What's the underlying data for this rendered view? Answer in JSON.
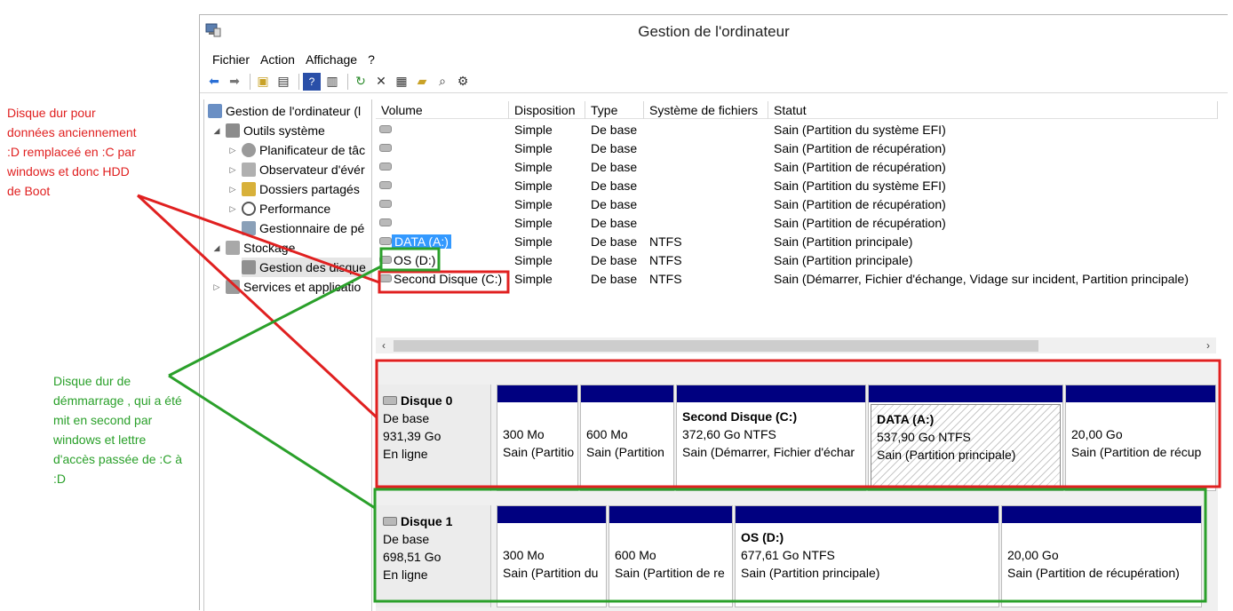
{
  "annotations": {
    "red_note": "Disque dur pour\ndonnées anciennement\n:D remplaceé en :C par\nwindows et donc HDD\nde Boot",
    "green_note": "Disque dur de\ndémmarrage , qui a été\nmit en second par\nwindows et lettre\nd'accès passée de :C à\n:D",
    "red_color": "#e02020",
    "green_color": "#2aa02a"
  },
  "window": {
    "title": "Gestion de l'ordinateur",
    "menu": [
      "Fichier",
      "Action",
      "Affichage",
      "?"
    ]
  },
  "tree": {
    "items": [
      {
        "label": "Gestion de l'ordinateur (l",
        "level": 0,
        "expander": "",
        "icon": "computer-management-icon"
      },
      {
        "label": "Outils système",
        "level": 1,
        "expander": "◢",
        "icon": "system-tools-icon"
      },
      {
        "label": "Planificateur de tâc",
        "level": 2,
        "expander": "▷",
        "icon": "task-scheduler-icon"
      },
      {
        "label": "Observateur d'évér",
        "level": 2,
        "expander": "▷",
        "icon": "event-viewer-icon"
      },
      {
        "label": "Dossiers partagés",
        "level": 2,
        "expander": "▷",
        "icon": "shared-folders-icon"
      },
      {
        "label": "Performance",
        "level": 2,
        "expander": "▷",
        "icon": "performance-icon"
      },
      {
        "label": "Gestionnaire de pé",
        "level": 2,
        "expander": "",
        "icon": "device-manager-icon"
      },
      {
        "label": "Stockage",
        "level": 1,
        "expander": "◢",
        "icon": "storage-icon"
      },
      {
        "label": "Gestion des disque",
        "level": 2,
        "expander": "",
        "icon": "disk-management-icon",
        "selected": true
      },
      {
        "label": "Services et applicatio",
        "level": 1,
        "expander": "▷",
        "icon": "services-icon"
      }
    ]
  },
  "volumes": {
    "columns": [
      "Volume",
      "Disposition",
      "Type",
      "Système de fichiers",
      "Statut"
    ],
    "rows": [
      {
        "name": "",
        "layout": "Simple",
        "type": "De base",
        "fs": "",
        "status": "Sain (Partition du système EFI)"
      },
      {
        "name": "",
        "layout": "Simple",
        "type": "De base",
        "fs": "",
        "status": "Sain (Partition de récupération)"
      },
      {
        "name": "",
        "layout": "Simple",
        "type": "De base",
        "fs": "",
        "status": "Sain (Partition de récupération)"
      },
      {
        "name": "",
        "layout": "Simple",
        "type": "De base",
        "fs": "",
        "status": "Sain (Partition du système EFI)"
      },
      {
        "name": "",
        "layout": "Simple",
        "type": "De base",
        "fs": "",
        "status": "Sain (Partition de récupération)"
      },
      {
        "name": "",
        "layout": "Simple",
        "type": "De base",
        "fs": "",
        "status": "Sain (Partition de récupération)"
      },
      {
        "name": "DATA (A:)",
        "layout": "Simple",
        "type": "De base",
        "fs": "NTFS",
        "status": "Sain (Partition principale)",
        "selected": true
      },
      {
        "name": "OS (D:)",
        "layout": "Simple",
        "type": "De base",
        "fs": "NTFS",
        "status": "Sain (Partition principale)"
      },
      {
        "name": "Second Disque (C:)",
        "layout": "Simple",
        "type": "De base",
        "fs": "NTFS",
        "status": "Sain (Démarrer, Fichier d'échange, Vidage sur incident, Partition principale)"
      }
    ]
  },
  "disks": [
    {
      "name": "Disque 0",
      "kind": "De base",
      "size": "931,39 Go",
      "state": "En ligne",
      "partitions": [
        {
          "title": "",
          "size": "300 Mo",
          "status": "Sain (Partitio"
        },
        {
          "title": "",
          "size": "600 Mo",
          "status": "Sain (Partition"
        },
        {
          "title": "Second Disque  (C:)",
          "size": "372,60 Go NTFS",
          "status": "Sain (Démarrer, Fichier d'échar"
        },
        {
          "title": "DATA  (A:)",
          "size": "537,90 Go NTFS",
          "status": "Sain (Partition principale)",
          "hatched": true
        },
        {
          "title": "",
          "size": "20,00 Go",
          "status": "Sain (Partition de récup"
        }
      ]
    },
    {
      "name": "Disque 1",
      "kind": "De base",
      "size": "698,51 Go",
      "state": "En ligne",
      "partitions": [
        {
          "title": "",
          "size": "300 Mo",
          "status": "Sain (Partition du"
        },
        {
          "title": "",
          "size": "600 Mo",
          "status": "Sain (Partition de re"
        },
        {
          "title": "OS  (D:)",
          "size": "677,61 Go NTFS",
          "status": "Sain (Partition principale)"
        },
        {
          "title": "",
          "size": "20,00 Go",
          "status": "Sain (Partition de récupération)"
        }
      ]
    }
  ]
}
